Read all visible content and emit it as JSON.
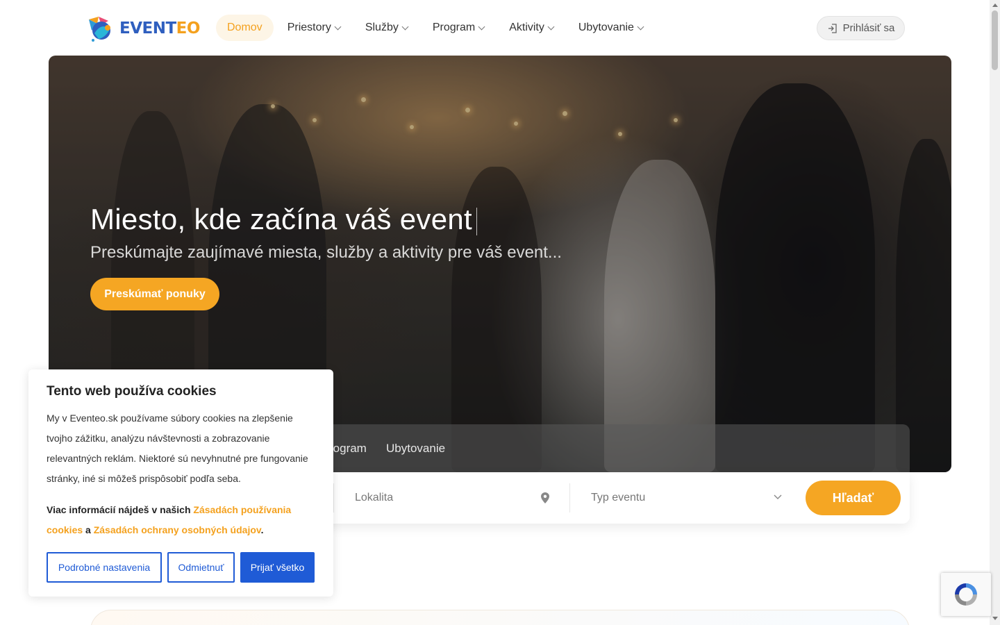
{
  "header": {
    "logo": {
      "part1": "EVENT",
      "part2": "EO"
    },
    "nav": [
      {
        "label": "Domov",
        "active": true,
        "dropdown": false
      },
      {
        "label": "Priestory",
        "active": false,
        "dropdown": true
      },
      {
        "label": "Služby",
        "active": false,
        "dropdown": true
      },
      {
        "label": "Program",
        "active": false,
        "dropdown": true
      },
      {
        "label": "Aktivity",
        "active": false,
        "dropdown": true
      },
      {
        "label": "Ubytovanie",
        "active": false,
        "dropdown": true
      }
    ],
    "login_label": "Prihlásiť sa",
    "login_icon": "login-icon"
  },
  "hero": {
    "title": "Miesto, kde začína váš event",
    "subtitle": "Preskúmajte zaujímavé miesta, služby a aktivity pre váš event...",
    "cta_label": "Preskúmať ponuky"
  },
  "search": {
    "tabs_visible": [
      "rogram",
      "Ubytovanie"
    ],
    "location_placeholder": "Lokalita",
    "location_icon": "map-pin-icon",
    "event_type_placeholder": "Typ eventu",
    "event_type_icon": "chevron-down-icon",
    "search_label": "Hľadať"
  },
  "cookie": {
    "title": "Tento web používa cookies",
    "text": "My v Eventeo.sk používame súbory cookies na zlepšenie tvojho zážitku, analýzu návštevnosti a zobrazovanie relevantných reklám.  Niektoré sú nevyhnutné pre fungovanie stránky, iné si môžeš prispôsobiť podľa seba.",
    "more_prefix": "Viac informácií nájdeš v našich ",
    "link1": "Zásadách používania cookies",
    "more_mid": " a ",
    "link2": "Zásadách ochrany osobných údajov",
    "more_suffix": ".",
    "btn_settings": "Podrobné nastavenia",
    "btn_reject": "Odmietnuť",
    "btn_accept": "Prijať všetko"
  },
  "colors": {
    "brand_orange": "#f5a623",
    "brand_blue": "#2f5fbf",
    "cookie_blue": "#1f5bd6"
  }
}
